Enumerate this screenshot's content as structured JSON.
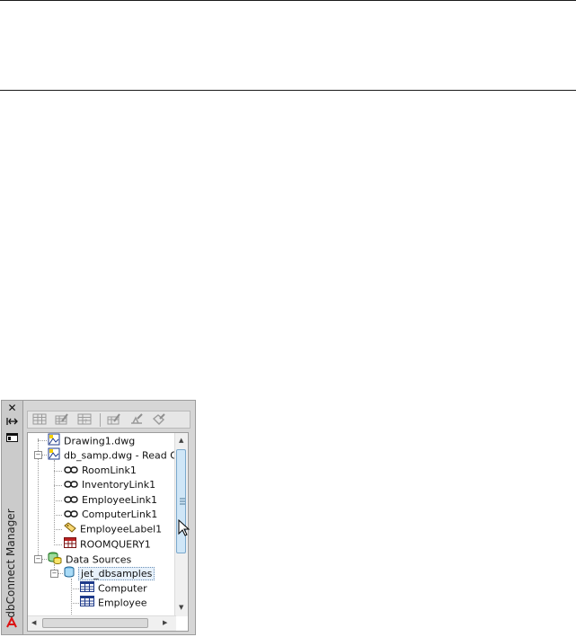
{
  "palette": {
    "vertical_title": "dbConnect Manager",
    "close_glyph": "✕"
  },
  "tree": {
    "items": [
      {
        "label": "Drawing1.dwg",
        "icon": "drawing-icon"
      },
      {
        "label": "db_samp.dwg - Read On",
        "icon": "drawing-icon"
      },
      {
        "label": "RoomLink1",
        "icon": "link-icon"
      },
      {
        "label": "InventoryLink1",
        "icon": "link-icon"
      },
      {
        "label": "EmployeeLink1",
        "icon": "link-icon"
      },
      {
        "label": "ComputerLink1",
        "icon": "link-icon"
      },
      {
        "label": "EmployeeLabel1",
        "icon": "label-icon"
      },
      {
        "label": "ROOMQUERY1",
        "icon": "query-icon"
      },
      {
        "label": "Data Sources",
        "icon": "data-sources-icon"
      },
      {
        "label": "jet_dbsamples",
        "icon": "database-icon"
      },
      {
        "label": "Computer",
        "icon": "table-icon"
      },
      {
        "label": "Employee",
        "icon": "table-icon"
      }
    ]
  },
  "colors": {
    "selection_bg": "#e7f1fb",
    "logo_red": "#d11111",
    "thumb_blue": "#cfe6f7"
  }
}
